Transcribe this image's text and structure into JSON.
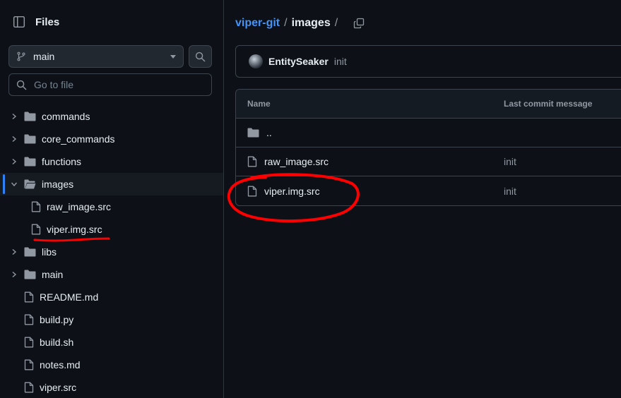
{
  "sidebar": {
    "title": "Files",
    "branch": "main",
    "goto_placeholder": "Go to file",
    "tree": [
      {
        "label": "commands",
        "type": "folder"
      },
      {
        "label": "core_commands",
        "type": "folder"
      },
      {
        "label": "functions",
        "type": "folder"
      },
      {
        "label": "images",
        "type": "folder-open"
      },
      {
        "label": "raw_image.src",
        "type": "file"
      },
      {
        "label": "viper.img.src",
        "type": "file"
      },
      {
        "label": "libs",
        "type": "folder"
      },
      {
        "label": "main",
        "type": "folder"
      },
      {
        "label": "README.md",
        "type": "file"
      },
      {
        "label": "build.py",
        "type": "file"
      },
      {
        "label": "build.sh",
        "type": "file"
      },
      {
        "label": "notes.md",
        "type": "file"
      },
      {
        "label": "viper.src",
        "type": "file"
      }
    ]
  },
  "breadcrumb": {
    "repo": "viper-git",
    "sep1": "/",
    "dir": "images",
    "sep2": "/"
  },
  "commit": {
    "author": "EntitySeaker",
    "message": "init"
  },
  "table": {
    "headers": [
      "Name",
      "Last commit message"
    ],
    "rows": [
      {
        "name": "..",
        "type": "folder",
        "message": ""
      },
      {
        "name": "raw_image.src",
        "type": "file",
        "message": "init"
      },
      {
        "name": "viper.img.src",
        "type": "file",
        "message": "init"
      }
    ]
  },
  "colors": {
    "background": "#0d1117",
    "link": "#4493f8",
    "annotation": "#ff0000",
    "selected_bar": "#2f81f7"
  }
}
